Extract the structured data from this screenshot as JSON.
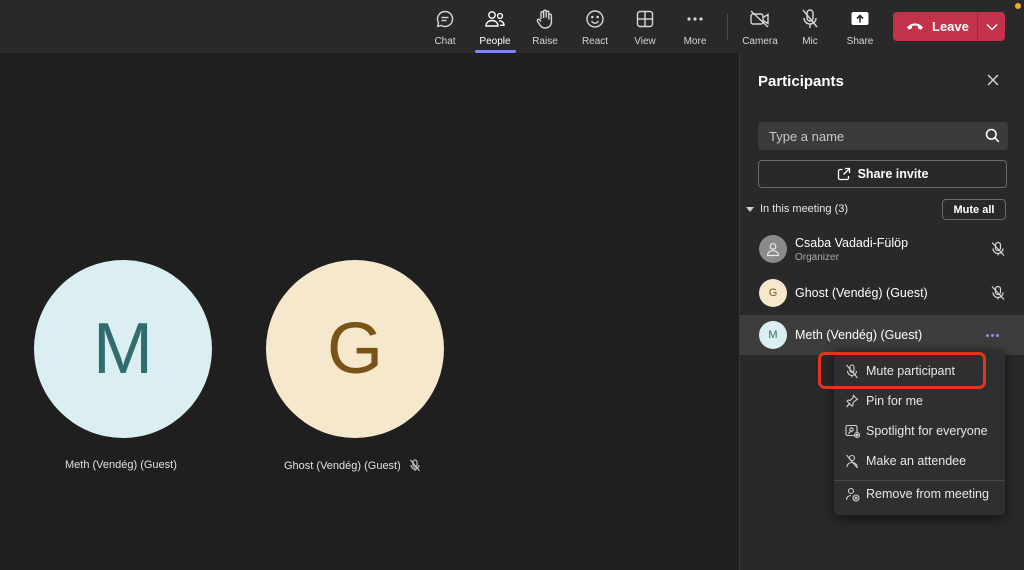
{
  "toolbar": {
    "items": [
      {
        "label": "Chat",
        "icon": "chat-icon"
      },
      {
        "label": "People",
        "icon": "people-icon",
        "active": true
      },
      {
        "label": "Raise",
        "icon": "raise-hand-icon"
      },
      {
        "label": "React",
        "icon": "react-icon"
      },
      {
        "label": "View",
        "icon": "view-icon"
      },
      {
        "label": "More",
        "icon": "more-icon"
      },
      {
        "label": "Camera",
        "icon": "camera-off-icon"
      },
      {
        "label": "Mic",
        "icon": "mic-off-icon"
      },
      {
        "label": "Share",
        "icon": "share-icon"
      }
    ],
    "leave_label": "Leave",
    "colors": {
      "leave": "#c4314b",
      "active_underline": "#7f85f5",
      "notification": "#f8a61c"
    }
  },
  "stage": {
    "tiles": [
      {
        "initial": "M",
        "name": "Meth (Vendég) (Guest)",
        "muted": false,
        "bg": "#dbeef2",
        "fg": "#2f6d6f"
      },
      {
        "initial": "G",
        "name": "Ghost (Vendég) (Guest)",
        "muted": true,
        "bg": "#f5e8cc",
        "fg": "#7a5316"
      }
    ]
  },
  "panel": {
    "title": "Participants",
    "search_placeholder": "Type a name",
    "share_invite_label": "Share invite",
    "section_label": "In this meeting (3)",
    "mute_all_label": "Mute all",
    "participants": [
      {
        "initial": "",
        "name": "Csaba Vadadi-Fülöp",
        "role": "Organizer",
        "muted": true
      },
      {
        "initial": "G",
        "name": "Ghost (Vendég) (Guest)",
        "role": "",
        "muted": true
      },
      {
        "initial": "M",
        "name": "Meth (Vendég) (Guest)",
        "role": "",
        "muted": false,
        "selected": true
      }
    ]
  },
  "context_menu": {
    "items": [
      {
        "label": "Mute participant",
        "icon": "mic-off-icon",
        "highlighted": true
      },
      {
        "label": "Pin for me",
        "icon": "pin-icon"
      },
      {
        "label": "Spotlight for everyone",
        "icon": "spotlight-icon"
      },
      {
        "label": "Make an attendee",
        "icon": "attendee-icon"
      },
      {
        "label": "Remove from meeting",
        "icon": "remove-person-icon"
      }
    ],
    "highlight_color": "#e8331c"
  }
}
